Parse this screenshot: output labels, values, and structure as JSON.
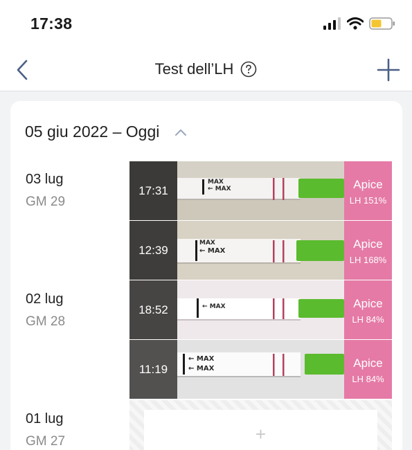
{
  "status_bar": {
    "time": "17:38",
    "signal_icon": "cellular-signal-icon",
    "wifi_icon": "wifi-icon",
    "battery_icon": "battery-icon",
    "battery_color": "#f5c531"
  },
  "nav": {
    "title": "Test dell’LH",
    "back_icon": "chevron-left-icon",
    "help_icon": "question-circle-icon",
    "add_icon": "plus-icon"
  },
  "period": {
    "title": "05 giu 2022 – Oggi",
    "toggle_icon": "chevron-up-icon"
  },
  "days": [
    {
      "date": "03 lug",
      "cycle_day": "GM 29"
    },
    {
      "date": "02 lug",
      "cycle_day": "GM 28"
    },
    {
      "date": "01 lug",
      "cycle_day": "GM 27"
    }
  ],
  "tests": [
    {
      "time": "17:31",
      "result": "Apice",
      "lh": "LH 151%"
    },
    {
      "time": "12:39",
      "result": "Apice",
      "lh": "LH 168%"
    },
    {
      "time": "18:52",
      "result": "Apice",
      "lh": "LH 84%"
    },
    {
      "time": "11:19",
      "result": "Apice",
      "lh": "LH 84%"
    }
  ],
  "strip": {
    "marker_text": "MAX"
  },
  "add_slot": {
    "label": "+"
  },
  "colors": {
    "peak": "#e57aa6",
    "strip_handle": "#5bbb2e",
    "accent_icon": "#4a5f85"
  }
}
